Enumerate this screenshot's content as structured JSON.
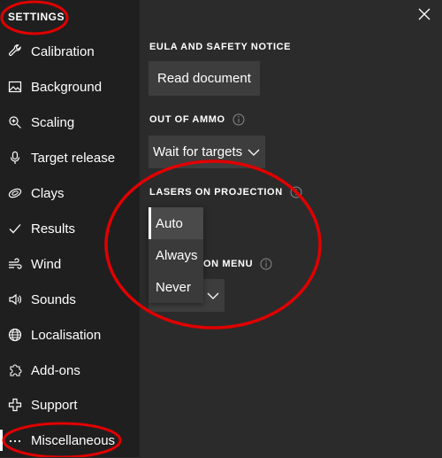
{
  "app": {
    "title": "SETTINGS"
  },
  "sidebar": {
    "items": [
      {
        "label": "Calibration",
        "icon": "wrench-icon"
      },
      {
        "label": "Background",
        "icon": "image-icon"
      },
      {
        "label": "Scaling",
        "icon": "zoom-icon"
      },
      {
        "label": "Target release",
        "icon": "microphone-icon"
      },
      {
        "label": "Clays",
        "icon": "clay-icon"
      },
      {
        "label": "Results",
        "icon": "checkmark-icon"
      },
      {
        "label": "Wind",
        "icon": "wind-icon"
      },
      {
        "label": "Sounds",
        "icon": "speaker-icon"
      },
      {
        "label": "Localisation",
        "icon": "globe-icon"
      },
      {
        "label": "Add-ons",
        "icon": "puzzle-icon"
      },
      {
        "label": "Support",
        "icon": "plus-icon"
      },
      {
        "label": "Miscellaneous",
        "icon": "more-icon"
      }
    ],
    "active": "Miscellaneous"
  },
  "main": {
    "eula": {
      "title": "EULA AND SAFETY NOTICE",
      "button_label": "Read document"
    },
    "out_of_ammo": {
      "title": "OUT OF AMMO",
      "value": "Wait for targets"
    },
    "lasers": {
      "title": "LASERS ON PROJECTION",
      "options": [
        "Auto",
        "Always",
        "Never"
      ],
      "selected": "Auto"
    },
    "navigation_menu": {
      "title": "ON MENU",
      "value": ""
    }
  },
  "colors": {
    "sidebar_bg": "#1f1f1f",
    "main_bg": "#2b2b2b",
    "control_bg": "#3d3d3d",
    "annotation": "#e00000"
  }
}
